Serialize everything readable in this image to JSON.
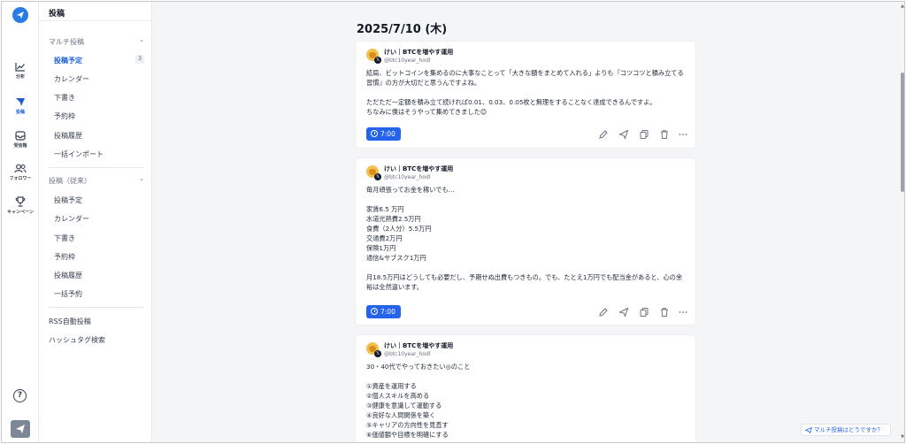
{
  "rail": {
    "items": [
      {
        "label": "分析",
        "icon": "chart-line-icon"
      },
      {
        "label": "投稿",
        "icon": "send-icon"
      },
      {
        "label": "受信箱",
        "icon": "inbox-icon"
      },
      {
        "label": "フォロワー",
        "icon": "users-icon"
      },
      {
        "label": "キャンペーン",
        "icon": "trophy-icon"
      }
    ],
    "help": "?"
  },
  "subnav": {
    "title": "投稿",
    "group1": {
      "label": "マルチ投稿",
      "items": [
        "投稿予定",
        "カレンダー",
        "下書き",
        "予約枠",
        "投稿履歴",
        "一括インポート"
      ],
      "scheduled_count": "3"
    },
    "group2": {
      "label": "投稿（従来）",
      "items": [
        "投稿予定",
        "カレンダー",
        "下書き",
        "予約枠",
        "投稿履歴",
        "一括予約"
      ]
    },
    "rss": "RSS自動投稿",
    "hashtag": "ハッシュタグ検索"
  },
  "main": {
    "date": "2025/7/10 (木)",
    "account_name": "けい｜BTCを増やす運用",
    "account_handle": "@btc10year_hodl",
    "posts": [
      {
        "body": "結局、ビットコインを集めるのに大事なことって「大きな額をまとめて入れる」よりも『コツコツと積み立てる習慣』の方が大切だと思うんですよね。\n\nただただ一定額を積み立て続ければ0.01、0.03、0.05枚と無理をすることなく達成できるんですよ。\nちなみに僕はそうやって集めてきました😊",
        "time": "7:00"
      },
      {
        "body": "毎月頑張ってお金を稼いでも…\n\n家賃6.5 万円\n水道光熱費2.5万円\n食費（2人分）5.5万円\n交通費2万円\n保険1万円\n通信&サブスク1万円\n\n月18.5万円はどうしても必要だし、予期せぬ出費もつきもの。でも、たとえ1万円でも配当金があると、心の余裕は全然違います。",
        "time": "7:00"
      },
      {
        "body": "30・40代でやっておきたい◎のこと\n\n①資産を運用する\n②個人スキルを高める\n③健康を意識して運動する\n④良好な人間関係を築く\n⑤キャリアの方向性を見直す\n⑥価値観や目標を明確にする",
        "time": ""
      }
    ]
  },
  "feedback": "マルチ投稿はどうですか？"
}
